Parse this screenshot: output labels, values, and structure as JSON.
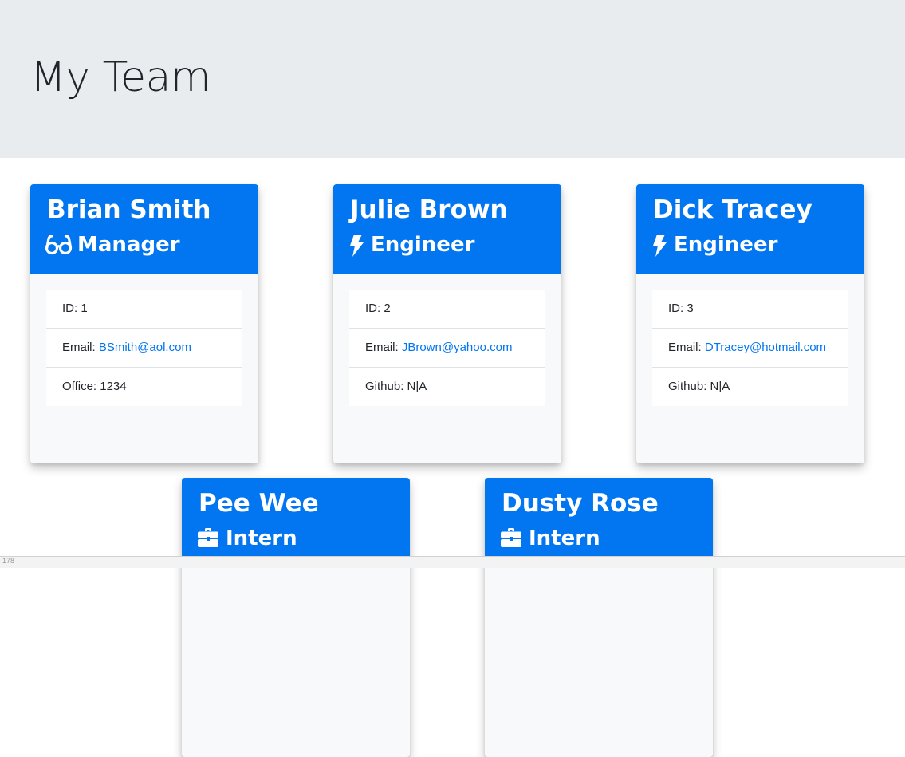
{
  "header": {
    "title": "My Team"
  },
  "cards": [
    {
      "name": "Brian Smith",
      "role": "Manager",
      "role_icon": "glasses-icon",
      "items": [
        {
          "label": "ID: ",
          "value": "1"
        },
        {
          "label": "Email: ",
          "value": "BSmith@aol.com"
        },
        {
          "label": "Office: ",
          "value": "1234"
        }
      ]
    },
    {
      "name": "Julie Brown",
      "role": "Engineer",
      "role_icon": "bolt-icon",
      "items": [
        {
          "label": "ID: ",
          "value": "2"
        },
        {
          "label": "Email: ",
          "value": "JBrown@yahoo.com"
        },
        {
          "label": "Github: ",
          "value": "N|A"
        }
      ]
    },
    {
      "name": "Dick Tracey",
      "role": "Engineer",
      "role_icon": "bolt-icon",
      "items": [
        {
          "label": "ID: ",
          "value": "3"
        },
        {
          "label": "Email: ",
          "value": "DTracey@hotmail.com"
        },
        {
          "label": "Github: ",
          "value": "N|A"
        }
      ]
    },
    {
      "name": "Pee Wee",
      "role": "Intern",
      "role_icon": "briefcase-icon"
    },
    {
      "name": "Dusty Rose",
      "role": "Intern",
      "role_icon": "briefcase-icon"
    }
  ],
  "colors": {
    "header_blue": "#0275f0",
    "jumbotron_gray": "#e9ecef",
    "card_bg": "#f8f9fa"
  },
  "status_bar": {
    "label": "178"
  }
}
